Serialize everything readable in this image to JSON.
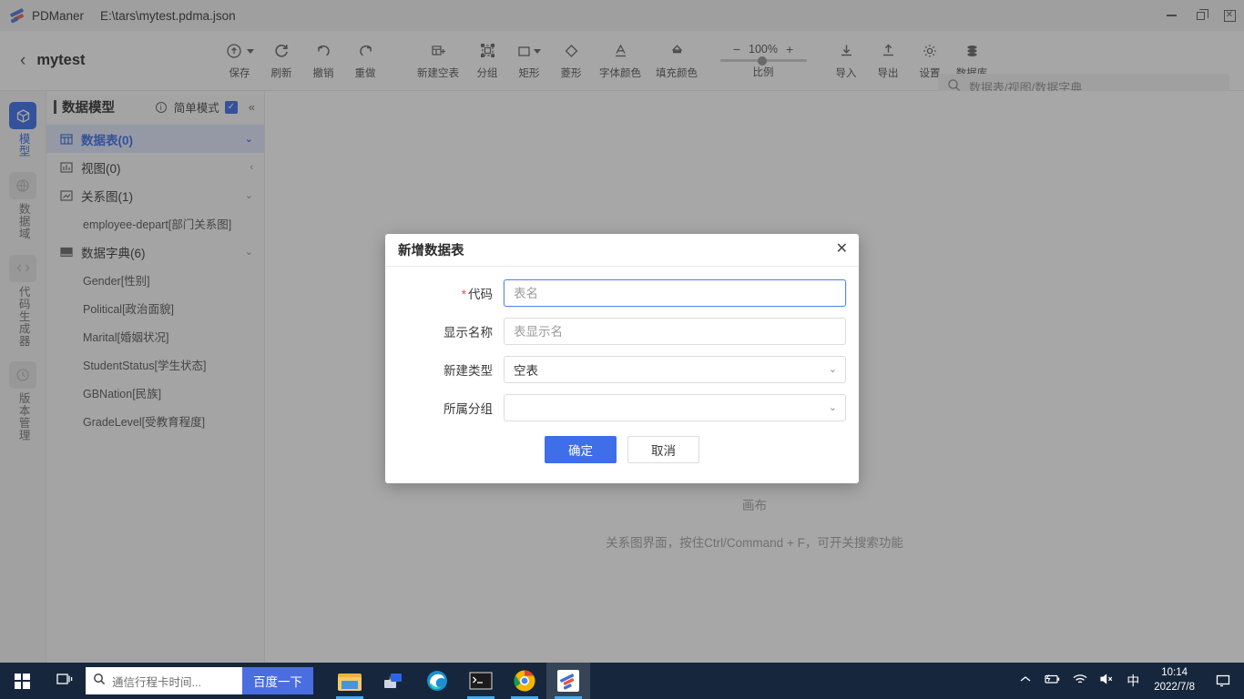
{
  "titlebar": {
    "app_name": "PDManer",
    "file_path": "E:\\tars\\mytest.pdma.json",
    "minimize": "minimize-button",
    "restore": "restore-button",
    "close": "close-button"
  },
  "toolbar": {
    "back_label": "mytest",
    "buttons": [
      {
        "label": "保存",
        "icon": "save-cloud-icon",
        "has_caret": true
      },
      {
        "label": "刷新",
        "icon": "refresh-icon",
        "has_caret": false
      },
      {
        "label": "撤销",
        "icon": "undo-icon",
        "has_caret": false
      },
      {
        "label": "重做",
        "icon": "redo-icon",
        "has_caret": false
      }
    ],
    "shape_buttons": [
      {
        "label": "新建空表",
        "icon": "new-table-icon",
        "has_caret": false
      },
      {
        "label": "分组",
        "icon": "group-icon",
        "has_caret": false
      },
      {
        "label": "矩形",
        "icon": "rectangle-icon",
        "has_caret": true
      },
      {
        "label": "菱形",
        "icon": "diamond-icon",
        "has_caret": false
      },
      {
        "label": "字体颜色",
        "icon": "font-color-icon",
        "has_caret": false
      },
      {
        "label": "填充颜色",
        "icon": "fill-color-icon",
        "has_caret": false
      }
    ],
    "zoom": {
      "minus": "−",
      "value": "100%",
      "plus": "+",
      "label": "比例",
      "percent": 100
    },
    "right_buttons": [
      {
        "label": "导入",
        "icon": "import-icon"
      },
      {
        "label": "导出",
        "icon": "export-icon"
      },
      {
        "label": "设置",
        "icon": "gear-icon"
      },
      {
        "label": "数据库",
        "icon": "database-icon"
      }
    ],
    "search": {
      "placeholder": "数据表/视图/数据字典",
      "value": ""
    }
  },
  "rail": {
    "items": [
      {
        "label": "模型",
        "icon": "cube-icon",
        "active": true
      },
      {
        "label": "数据域",
        "icon": "domain-icon",
        "active": false
      },
      {
        "label": "代码生成器",
        "icon": "code-gen-icon",
        "active": false
      },
      {
        "label": "版本管理",
        "icon": "version-icon",
        "active": false
      }
    ]
  },
  "sidebar": {
    "title": "数据模型",
    "simple_mode_label": "简单模式",
    "simple_mode_checked": true,
    "collapse_icon": "double-chevron-left-icon",
    "tree": [
      {
        "type": "node",
        "label": "数据表(0)",
        "icon": "table-icon",
        "selected": true,
        "arrow": "chevron-down-icon"
      },
      {
        "type": "node",
        "label": "视图(0)",
        "icon": "view-chart-icon",
        "selected": false,
        "arrow": "chevron-left-icon"
      },
      {
        "type": "node",
        "label": "关系图(1)",
        "icon": "relation-graph-icon",
        "selected": false,
        "arrow": "chevron-down-icon"
      },
      {
        "type": "leaf",
        "label": "employee-depart[部门关系图]"
      },
      {
        "type": "node",
        "label": "数据字典(6)",
        "icon": "dictionary-icon",
        "selected": false,
        "arrow": "chevron-down-icon"
      },
      {
        "type": "leaf",
        "label": "Gender[性别]"
      },
      {
        "type": "leaf",
        "label": "Political[政治面貌]"
      },
      {
        "type": "leaf",
        "label": "Marital[婚姻状况]"
      },
      {
        "type": "leaf",
        "label": "StudentStatus[学生状态]"
      },
      {
        "type": "leaf",
        "label": "GBNation[民族]"
      },
      {
        "type": "leaf",
        "label": "GradeLevel[受教育程度]"
      }
    ]
  },
  "canvas": {
    "hint_line1": "画布",
    "hint_line2": "关系图界面，按住Ctrl/Command + F，可开关搜索功能"
  },
  "modal": {
    "title": "新增数据表",
    "close_icon": "close-icon",
    "fields": [
      {
        "label": "代码",
        "required": true,
        "type": "input",
        "value": "",
        "placeholder": "表名",
        "focused": true
      },
      {
        "label": "显示名称",
        "required": false,
        "type": "input",
        "value": "",
        "placeholder": "表显示名",
        "focused": false
      },
      {
        "label": "新建类型",
        "required": false,
        "type": "select",
        "value": "空表",
        "placeholder": ""
      },
      {
        "label": "所属分组",
        "required": false,
        "type": "select",
        "value": "",
        "placeholder": ""
      }
    ],
    "confirm_label": "确定",
    "cancel_label": "取消"
  },
  "taskbar": {
    "start_icon": "windows-start-icon",
    "taskview_icon": "task-view-icon",
    "search_placeholder": "通信行程卡时间...",
    "search_icon": "search-icon",
    "baidu_label": "百度一下",
    "apps": [
      {
        "name": "file-explorer-icon",
        "active": false,
        "running": true
      },
      {
        "name": "remote-desktop-icon",
        "active": false,
        "running": false
      },
      {
        "name": "edge-browser-icon",
        "active": false,
        "running": true
      },
      {
        "name": "command-prompt-icon",
        "active": false,
        "running": true
      },
      {
        "name": "chrome-browser-icon",
        "active": false,
        "running": true
      },
      {
        "name": "pdmaner-app-icon",
        "active": true,
        "running": true
      }
    ],
    "tray": {
      "overflow_icon": "chevron-up-icon",
      "battery_icon": "battery-charging-icon",
      "wifi_icon": "wifi-icon",
      "volume_icon": "volume-muted-icon",
      "ime_label": "中",
      "time": "10:14",
      "date": "2022/7/8",
      "notification_icon": "notification-icon"
    }
  },
  "colors": {
    "accent": "#2f63e8",
    "button_primary": "#3f6fe8",
    "selected_bg": "#dfe6fb",
    "taskbar_bg": "#16263c",
    "required_red": "#e8544a"
  }
}
